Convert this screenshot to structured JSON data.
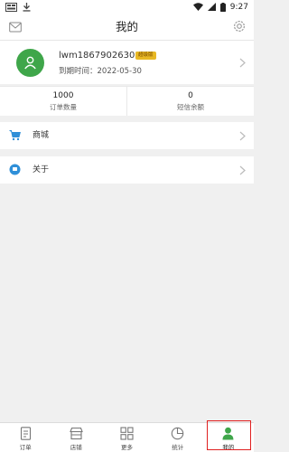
{
  "status_bar": {
    "time": "9:27"
  },
  "header": {
    "title": "我的",
    "mail_icon": "mail-icon",
    "settings_icon": "gear-icon"
  },
  "profile": {
    "username": "lwm18679026301",
    "badge": "超级版",
    "expire": "到期时间：2022-05-30",
    "avatar_color": "#3fa64a"
  },
  "stats": [
    {
      "value": "1000",
      "label": "订单数量"
    },
    {
      "value": "0",
      "label": "短信余额"
    }
  ],
  "menu": [
    {
      "label": "商城",
      "icon": "cart-icon"
    },
    {
      "label": "关于",
      "icon": "info-icon"
    }
  ],
  "tabbar": {
    "active_index": 4,
    "highlight_color": "#e02020",
    "items": [
      {
        "label": "订单",
        "icon": "document-icon"
      },
      {
        "label": "店铺",
        "icon": "store-icon"
      },
      {
        "label": "更多",
        "icon": "grid-icon"
      },
      {
        "label": "统计",
        "icon": "pie-chart-icon"
      },
      {
        "label": "我的",
        "icon": "person-icon"
      }
    ]
  }
}
